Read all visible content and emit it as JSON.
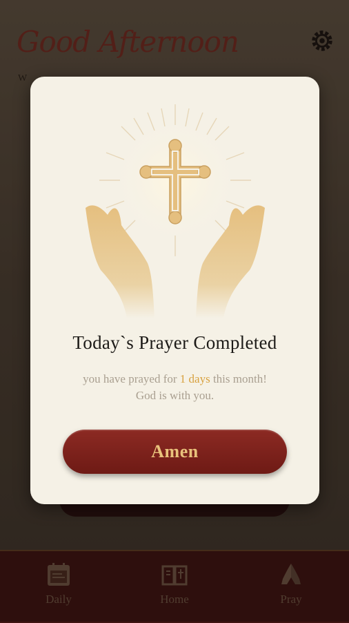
{
  "background": {
    "greeting": "Good Afternoon",
    "greeting_sub": "W"
  },
  "tabs": [
    {
      "label": "Daily",
      "icon": "calendar-icon"
    },
    {
      "label": "Home",
      "icon": "bible-icon"
    },
    {
      "label": "Pray",
      "icon": "praying-hands-icon"
    }
  ],
  "modal": {
    "title": "Today`s Prayer Completed",
    "message_before": "you have prayed for ",
    "days": "1 days",
    "message_after": " this month!",
    "message_line2": "God is with you.",
    "button_label": "Amen"
  },
  "colors": {
    "accent_red": "#7a201a",
    "gold": "#e9c27c",
    "days_highlight": "#d8a13f"
  }
}
